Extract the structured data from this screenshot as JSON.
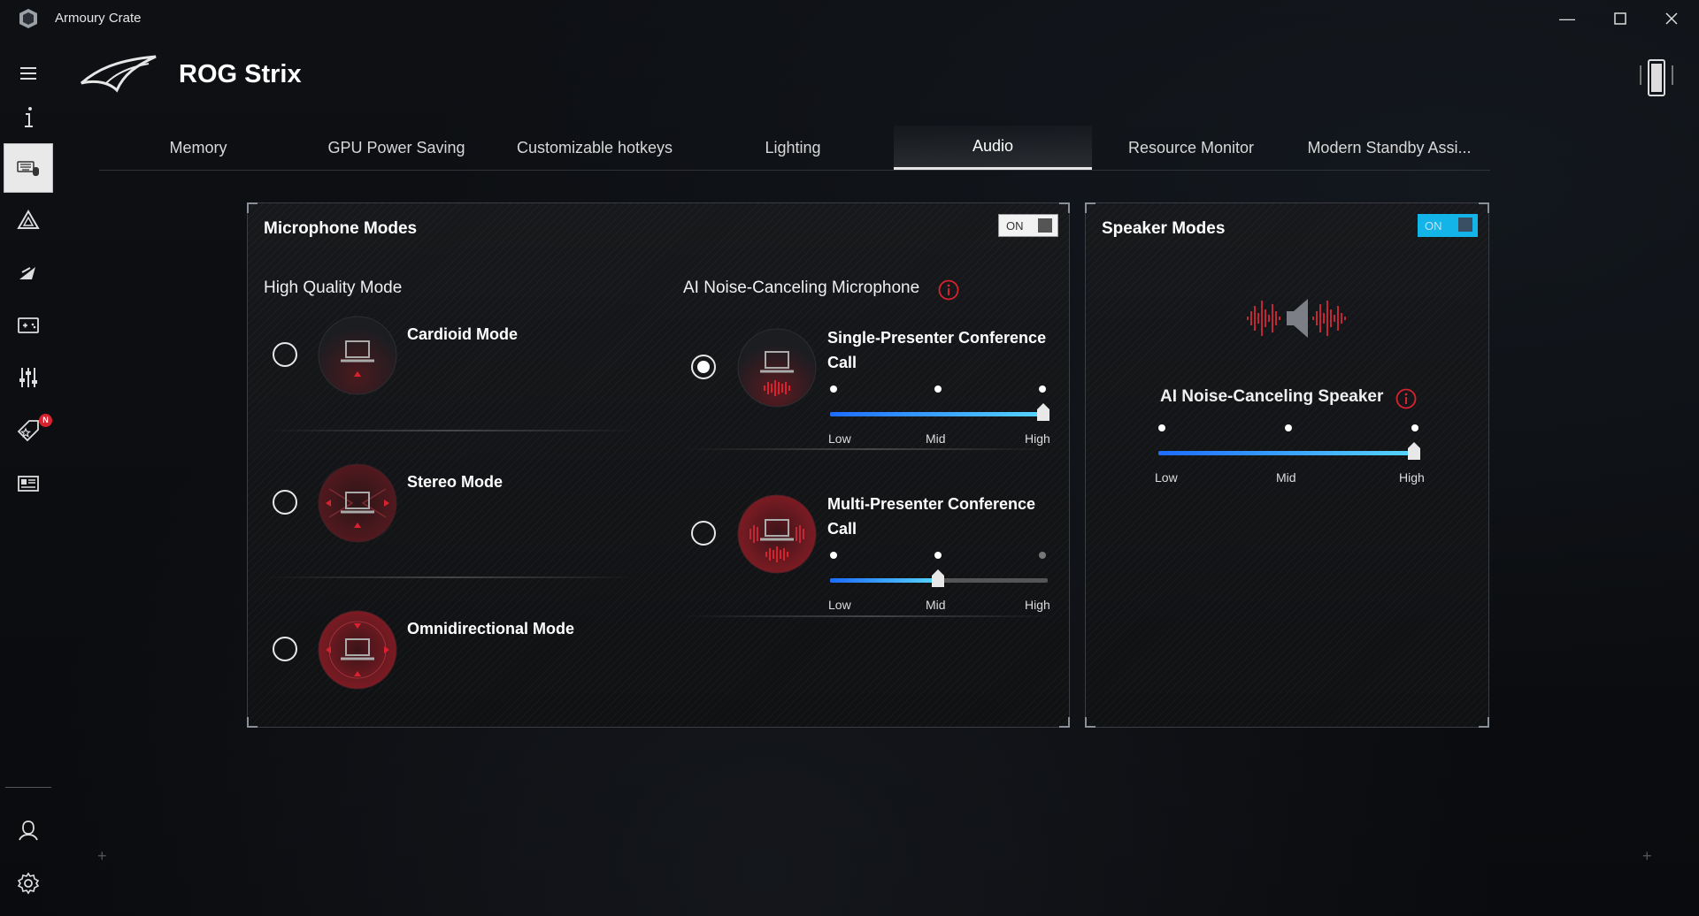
{
  "window": {
    "title": "Armoury Crate"
  },
  "device": {
    "name": "ROG Strix"
  },
  "tabs": [
    {
      "label": "Memory"
    },
    {
      "label": "GPU Power Saving"
    },
    {
      "label": "Customizable hotkeys"
    },
    {
      "label": "Lighting"
    },
    {
      "label": "Audio"
    },
    {
      "label": "Resource Monitor"
    },
    {
      "label": "Modern Standby Assi..."
    }
  ],
  "active_tab": "Audio",
  "sidebar": {
    "badge": "N"
  },
  "microphone": {
    "title": "Microphone Modes",
    "toggle": "ON",
    "high_quality_title": "High Quality Mode",
    "ai_title": "AI Noise-Canceling Microphone",
    "modes": [
      {
        "label": "Cardioid Mode",
        "selected": false
      },
      {
        "label": "Stereo Mode",
        "selected": false
      },
      {
        "label": "Omnidirectional Mode",
        "selected": false
      }
    ],
    "ai_modes": [
      {
        "label_line1": "Single-Presenter Conference",
        "label_line2": "Call",
        "selected": true,
        "level": "High"
      },
      {
        "label_line1": "Multi-Presenter Conference",
        "label_line2": "Call",
        "selected": false,
        "level": "Mid"
      }
    ]
  },
  "speaker": {
    "title": "Speaker Modes",
    "toggle": "ON",
    "ai_title": "AI Noise-Canceling Speaker",
    "level": "High"
  },
  "slider_labels": {
    "low": "Low",
    "mid": "Mid",
    "high": "High"
  },
  "colors": {
    "accent_red": "#d8232f",
    "slider_blue": "#1d6cff",
    "slider_cyan": "#56d6ff",
    "toggle_cyan": "#13b4e8"
  }
}
